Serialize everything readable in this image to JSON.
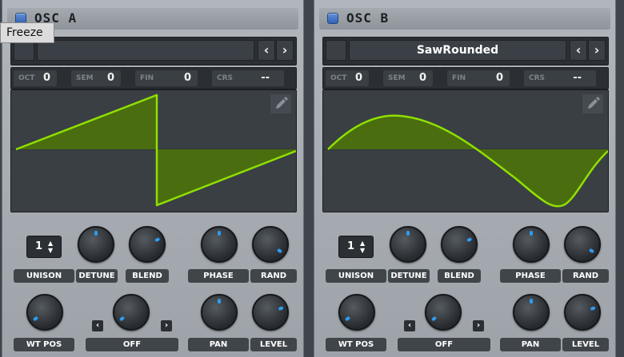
{
  "tooltip": "Freeze",
  "osc_a": {
    "title": "OSC A",
    "wavetable_name": "",
    "tuning": [
      {
        "label": "OCT",
        "value": "0"
      },
      {
        "label": "SEM",
        "value": "0"
      },
      {
        "label": "FIN",
        "value": "0"
      },
      {
        "label": "CRS",
        "value": "--"
      }
    ],
    "unison_value": "1",
    "knobs": {
      "detune": "DETUNE",
      "blend": "BLEND",
      "phase": "PHASE",
      "rand": "RAND",
      "wt_pos": "WT POS",
      "pan": "PAN",
      "level": "LEVEL"
    },
    "unison_label": "UNISON",
    "warp_mode": "OFF",
    "arrows": {
      "prev": "‹",
      "next": "›",
      "small_prev": "‹",
      "small_next": "›"
    }
  },
  "osc_b": {
    "title": "OSC B",
    "wavetable_name": "SawRounded",
    "tuning": [
      {
        "label": "OCT",
        "value": "0"
      },
      {
        "label": "SEM",
        "value": "0"
      },
      {
        "label": "FIN",
        "value": "0"
      },
      {
        "label": "CRS",
        "value": "--"
      }
    ],
    "unison_value": "1",
    "knobs": {
      "detune": "DETUNE",
      "blend": "BLEND",
      "phase": "PHASE",
      "rand": "RAND",
      "wt_pos": "WT POS",
      "pan": "PAN",
      "level": "LEVEL"
    },
    "unison_label": "UNISON",
    "warp_mode": "OFF",
    "arrows": {
      "prev": "‹",
      "next": "›",
      "small_prev": "‹",
      "small_next": "›"
    }
  },
  "colors": {
    "wave_line": "#8fe000",
    "wave_fill": "#4a6d10",
    "knob_indicator": "#2f9cf0",
    "power_button": "#3f75cf"
  },
  "icons": {
    "power": "power-button-icon",
    "edit": "pencil-icon",
    "stepper": "up-down-arrows-icon"
  }
}
